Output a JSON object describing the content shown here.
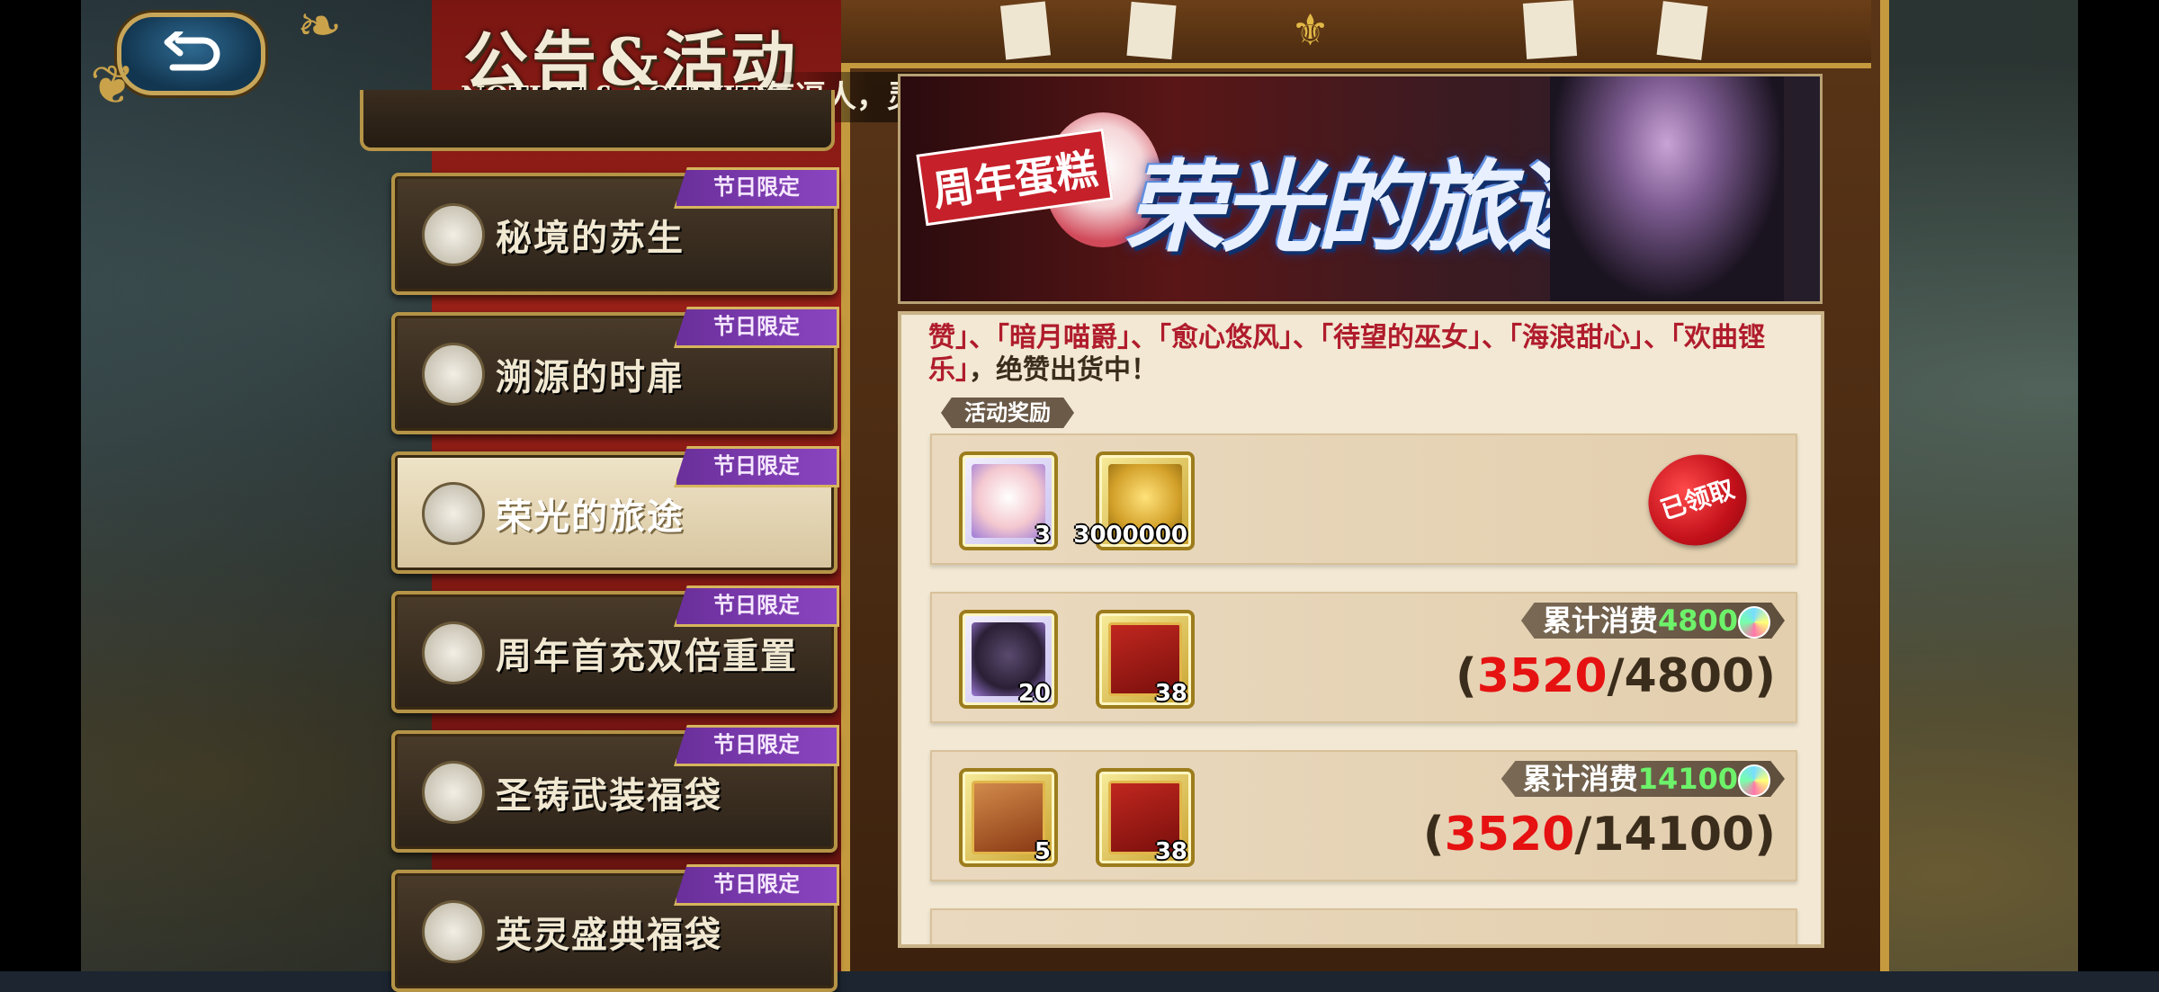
{
  "header": {
    "title_cn": "公告&活动",
    "title_en": "NOTICE & ACTIVITY",
    "ticker": "气逼人，灵光一闪，获得SSR英雄女神化身！！！"
  },
  "sidebar": {
    "items": [
      {
        "label": "秘境的苏生",
        "badge": "节日限定",
        "icon": "pocket-watch-icon",
        "active": false
      },
      {
        "label": "溯源的时扉",
        "badge": "节日限定",
        "icon": "pocket-watch-icon",
        "active": false
      },
      {
        "label": "荣光的旅途",
        "badge": "节日限定",
        "icon": "shield-emblem-icon",
        "active": true
      },
      {
        "label": "周年首充双倍重置",
        "badge": "节日限定",
        "icon": "shield-emblem-icon",
        "active": false
      },
      {
        "label": "圣铸武装福袋",
        "badge": "节日限定",
        "icon": "shield-emblem-icon",
        "active": false
      },
      {
        "label": "英灵盛典福袋",
        "badge": "节日限定",
        "icon": "shield-emblem-icon",
        "active": false
      }
    ]
  },
  "banner": {
    "badge": "周年蛋糕",
    "title": "荣光的旅途"
  },
  "content": {
    "description_red": "赞」、「暗月喵爵」、「愈心悠风」、「待望的巫女」、「海浪甜心」、「欢曲铿乐」",
    "description_plain": "，绝赞出货中！",
    "section_tag": "活动奖励",
    "rows": [
      {
        "rewards": [
          {
            "count": "3",
            "icon": "cake-item-icon"
          },
          {
            "count": "3000000",
            "icon": "gold-coin-icon"
          }
        ],
        "claimed_label": "已领取"
      },
      {
        "rewards": [
          {
            "count": "20",
            "icon": "jar-item-icon"
          },
          {
            "count": "38",
            "icon": "red-card-icon"
          }
        ],
        "cost_label": "累计消费",
        "cost_value": "4800",
        "progress_current": "3520",
        "progress_total": "/4800)",
        "progress_open": "("
      },
      {
        "rewards": [
          {
            "count": "5",
            "icon": "scroll-card-icon"
          },
          {
            "count": "38",
            "icon": "red-card-icon"
          }
        ],
        "cost_label": "累计消费",
        "cost_value": "14100",
        "progress_current": "3520",
        "progress_total": "/14100)",
        "progress_open": "("
      }
    ]
  },
  "colors": {
    "accent_red": "#e61111",
    "cost_green": "#6df26a",
    "badge_purple": "#7a3bb0",
    "gold_frame": "#c59a3e"
  }
}
